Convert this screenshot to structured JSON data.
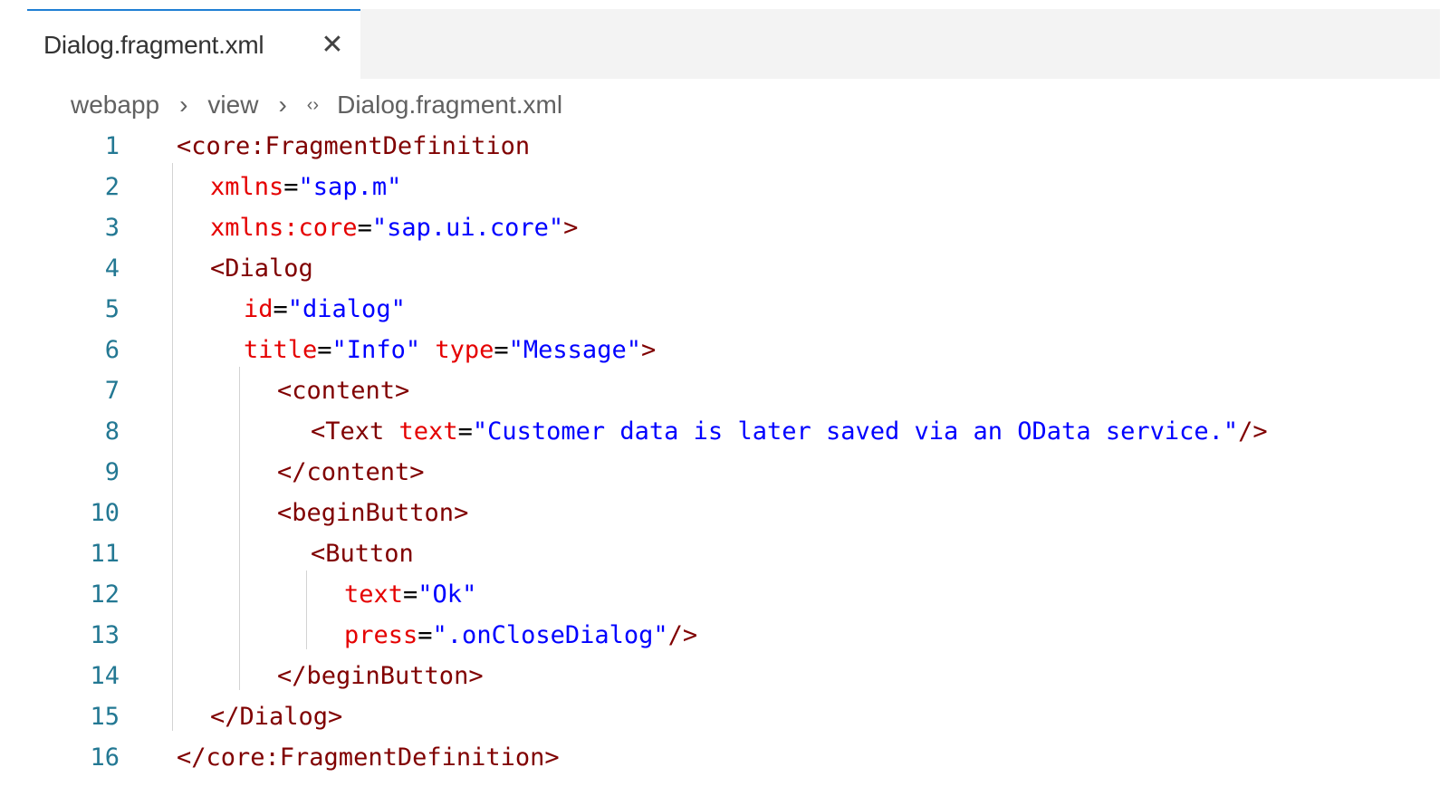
{
  "tab": {
    "title": "Dialog.fragment.xml",
    "close_icon": "close-icon"
  },
  "breadcrumb": {
    "items": [
      "webapp",
      "view",
      "Dialog.fragment.xml"
    ],
    "separator_icon": "chevron-right-icon",
    "file_icon": "xml-code-icon"
  },
  "code": {
    "lines": [
      {
        "n": "1",
        "indent": 0,
        "tokens": [
          [
            "tag",
            "<core:FragmentDefinition"
          ]
        ]
      },
      {
        "n": "2",
        "indent": 1,
        "tokens": [
          [
            "attr",
            "xmlns"
          ],
          [
            "eq",
            "="
          ],
          [
            "str",
            "\"sap.m\""
          ]
        ]
      },
      {
        "n": "3",
        "indent": 1,
        "tokens": [
          [
            "attr",
            "xmlns:core"
          ],
          [
            "eq",
            "="
          ],
          [
            "str",
            "\"sap.ui.core\""
          ],
          [
            "tag",
            ">"
          ]
        ]
      },
      {
        "n": "4",
        "indent": 1,
        "tokens": [
          [
            "tag",
            "<Dialog"
          ]
        ]
      },
      {
        "n": "5",
        "indent": 2,
        "tokens": [
          [
            "attr",
            "id"
          ],
          [
            "eq",
            "="
          ],
          [
            "str",
            "\"dialog\""
          ]
        ]
      },
      {
        "n": "6",
        "indent": 2,
        "tokens": [
          [
            "attr",
            "title"
          ],
          [
            "eq",
            "="
          ],
          [
            "str",
            "\"Info\""
          ],
          [
            "eq",
            " "
          ],
          [
            "attr",
            "type"
          ],
          [
            "eq",
            "="
          ],
          [
            "str",
            "\"Message\""
          ],
          [
            "tag",
            ">"
          ]
        ]
      },
      {
        "n": "7",
        "indent": 3,
        "tokens": [
          [
            "tag",
            "<content>"
          ]
        ]
      },
      {
        "n": "8",
        "indent": 4,
        "tokens": [
          [
            "tag",
            "<Text"
          ],
          [
            "eq",
            " "
          ],
          [
            "attr",
            "text"
          ],
          [
            "eq",
            "="
          ],
          [
            "str",
            "\"Customer data is later saved via an OData service.\""
          ],
          [
            "tag",
            "/>"
          ]
        ]
      },
      {
        "n": "9",
        "indent": 3,
        "tokens": [
          [
            "tag",
            "</content>"
          ]
        ]
      },
      {
        "n": "10",
        "indent": 3,
        "tokens": [
          [
            "tag",
            "<beginButton>"
          ]
        ]
      },
      {
        "n": "11",
        "indent": 4,
        "tokens": [
          [
            "tag",
            "<Button"
          ]
        ]
      },
      {
        "n": "12",
        "indent": 5,
        "tokens": [
          [
            "attr",
            "text"
          ],
          [
            "eq",
            "="
          ],
          [
            "str",
            "\"Ok\""
          ]
        ]
      },
      {
        "n": "13",
        "indent": 5,
        "tokens": [
          [
            "attr",
            "press"
          ],
          [
            "eq",
            "="
          ],
          [
            "str",
            "\".onCloseDialog\""
          ],
          [
            "tag",
            "/>"
          ]
        ]
      },
      {
        "n": "14",
        "indent": 3,
        "tokens": [
          [
            "tag",
            "</beginButton>"
          ]
        ]
      },
      {
        "n": "15",
        "indent": 1,
        "tokens": [
          [
            "tag",
            "</Dialog>"
          ]
        ]
      },
      {
        "n": "16",
        "indent": 0,
        "tokens": [
          [
            "tag",
            "</core:FragmentDefinition>"
          ]
        ]
      }
    ]
  },
  "colors": {
    "tag": "#800000",
    "attribute": "#e50000",
    "string": "#0000ff",
    "line_number": "#237893",
    "active_tab_border": "#1f7fd4"
  }
}
